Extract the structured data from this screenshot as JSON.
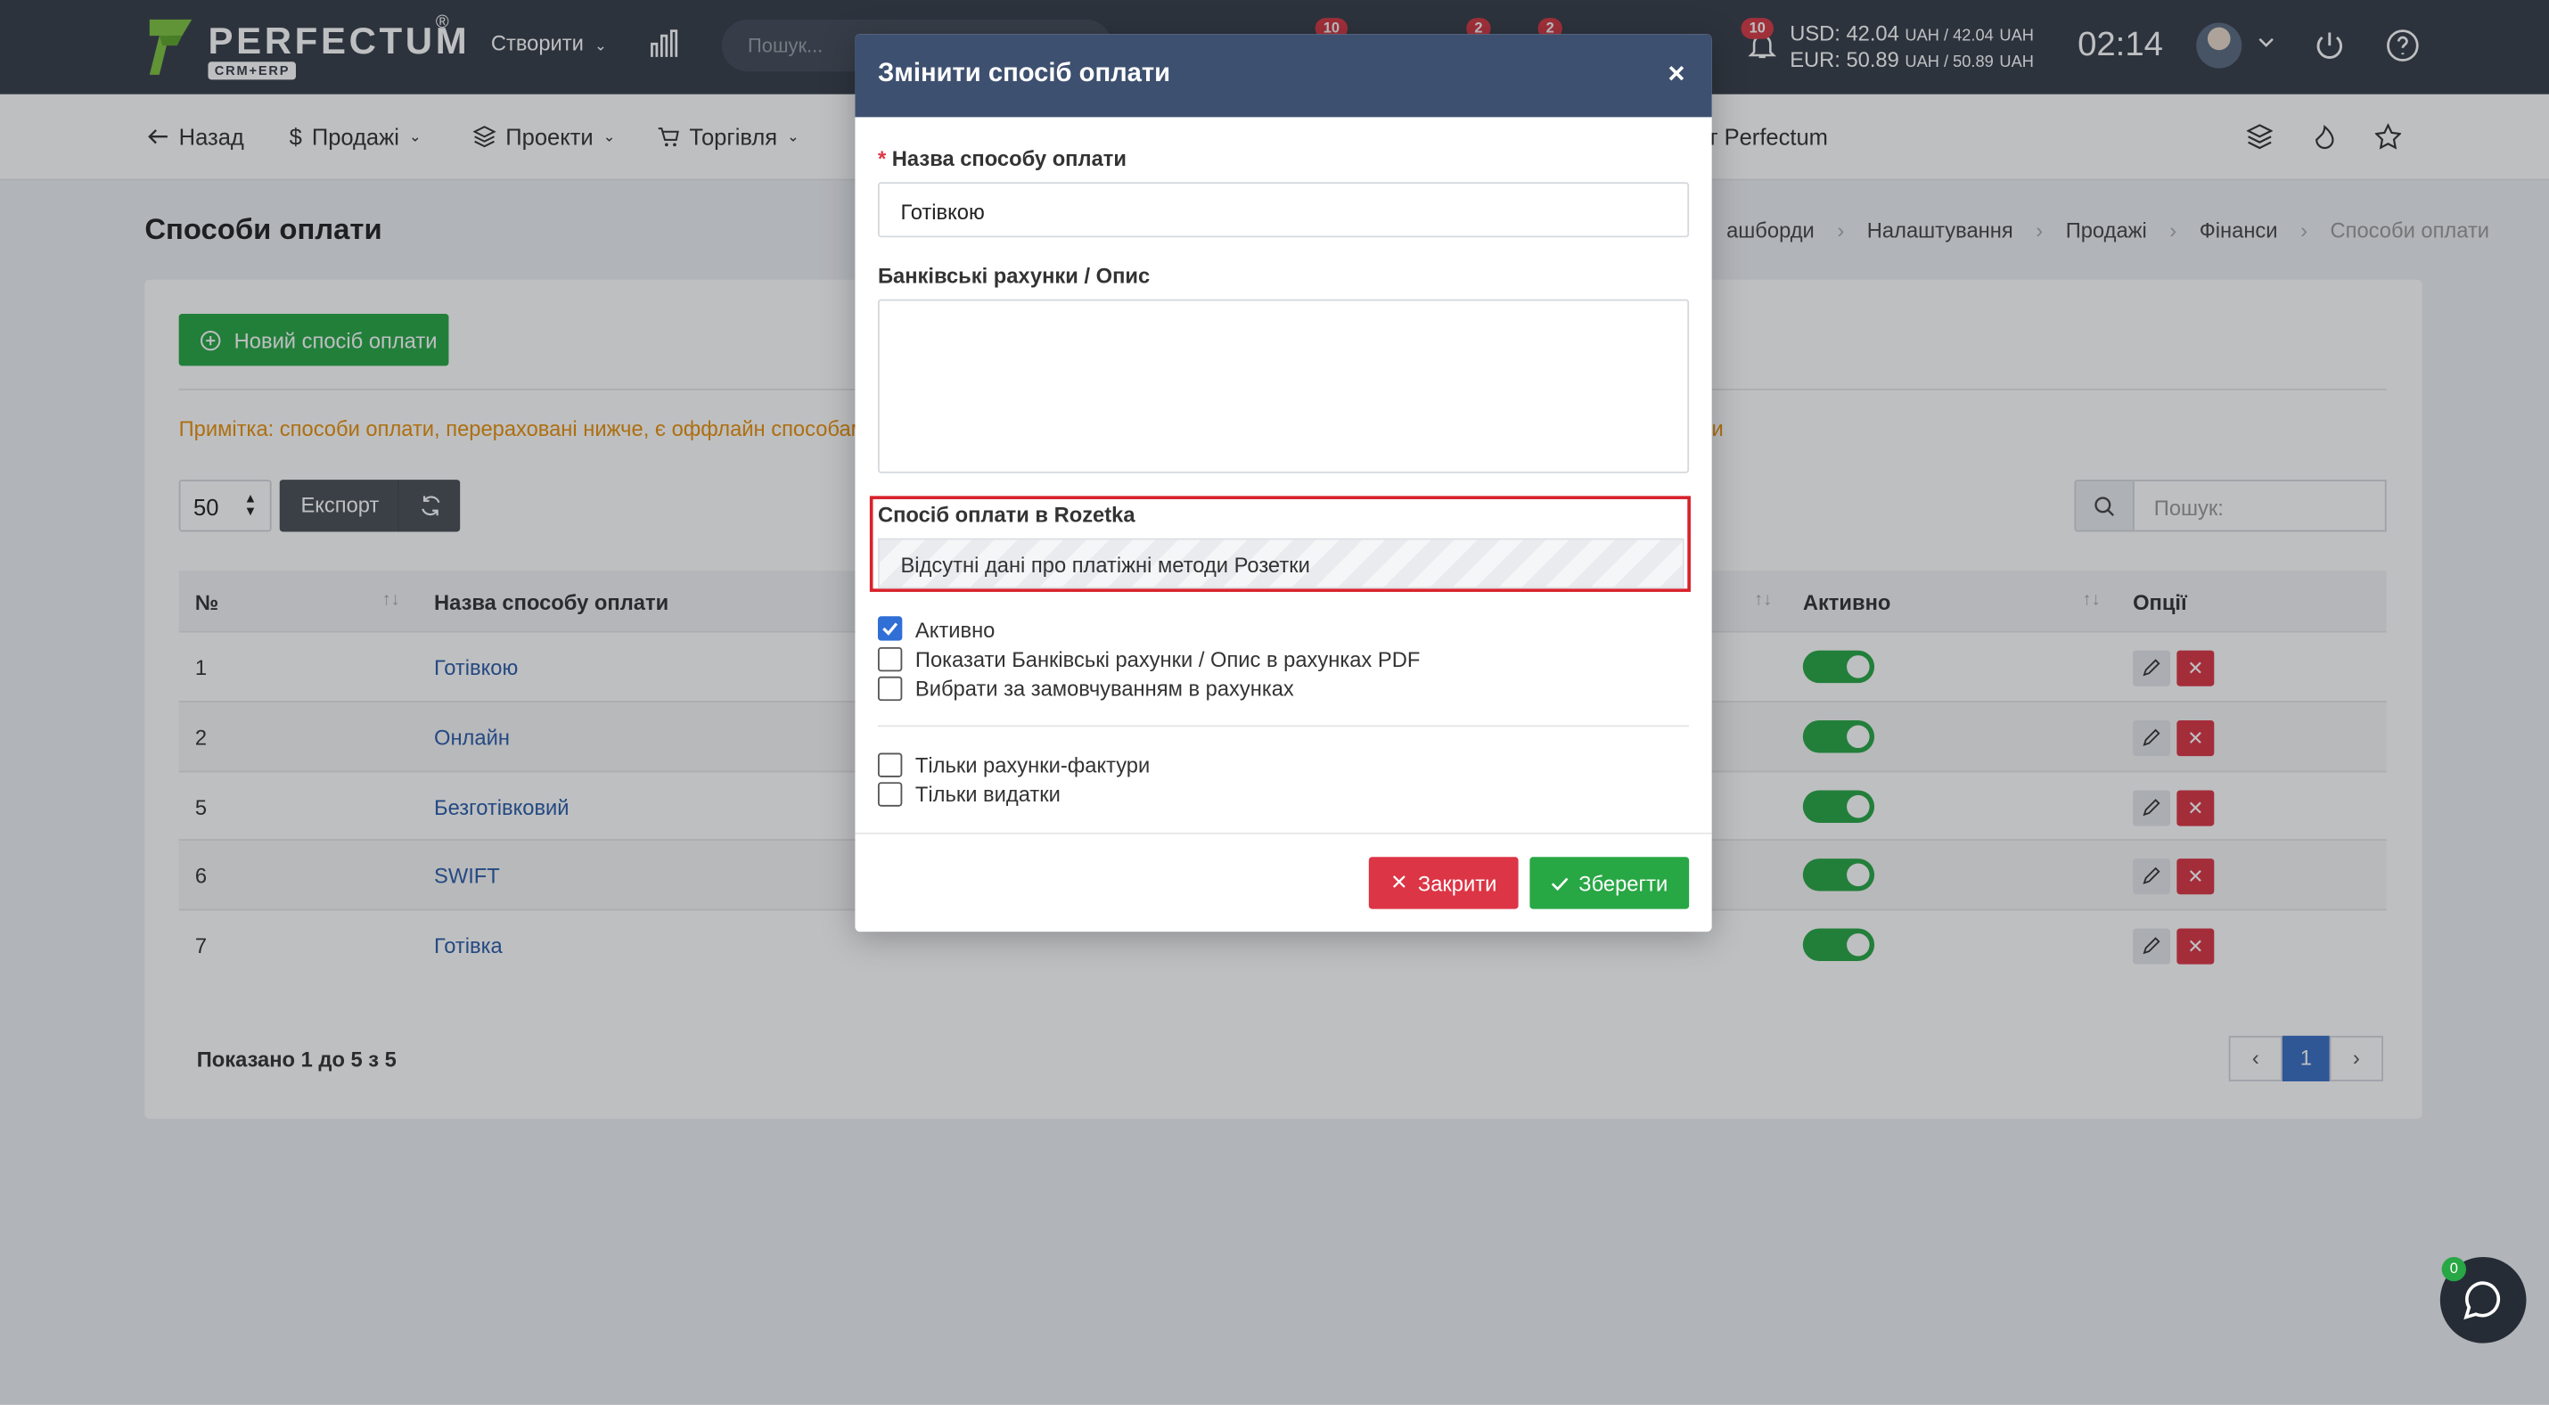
{
  "topbar": {
    "logo_text": "PERFECTUM",
    "logo_reg": "®",
    "logo_sub": "CRM+ERP",
    "create_label": "Створити",
    "search_placeholder": "Пошук...",
    "badges": [
      "10",
      "2",
      "2",
      "10"
    ],
    "currency_usd": "USD: 42.04",
    "currency_usd_unit": "UAH / 42.04",
    "currency_eur": "EUR: 50.89",
    "currency_eur_unit": "UAH / 50.89",
    "currency_unit": "UAH",
    "time": "02:14"
  },
  "nav": {
    "back": "Назад",
    "sales": "Продажі",
    "projects": "Проекти",
    "trade": "Торгівля",
    "perfectum": "ет Perfectum"
  },
  "page": {
    "title": "Способи оплати",
    "breadcrumb": [
      "ашборди",
      "Налаштування",
      "Продажі",
      "Фінанси",
      "Способи оплати"
    ]
  },
  "toolbar": {
    "new_button": "Новий спосіб оплати",
    "note_left": "Примітка: способи оплати, перераховані нижче, є оффлайн способами.",
    "note_right": "ми",
    "page_size": "50",
    "export": "Експорт",
    "search_placeholder": "Пошук:"
  },
  "table": {
    "headers": {
      "num": "№",
      "name": "Назва способу оплати",
      "active": "Активно",
      "options": "Опції"
    },
    "rows": [
      {
        "num": "1",
        "name": "Готівкою",
        "active": true
      },
      {
        "num": "2",
        "name": "Онлайн",
        "active": true
      },
      {
        "num": "5",
        "name": "Безготівковий",
        "active": true
      },
      {
        "num": "6",
        "name": "SWIFT",
        "active": true
      },
      {
        "num": "7",
        "name": "Готівка",
        "active": true
      }
    ],
    "footer": "Показано 1 до 5 з 5",
    "current_page": "1"
  },
  "modal": {
    "title": "Змінити спосіб оплати",
    "close_x": "×",
    "name_label": "Назва способу оплати",
    "name_required": "*",
    "name_value": "Готівкою",
    "desc_label": "Банківські рахунки / Опис",
    "desc_value": "",
    "rozetka_label": "Спосіб оплати в Rozetka",
    "rozetka_value": "Відсутні дані про платіжні методи Розетки",
    "checkboxes": [
      {
        "label": "Активно",
        "checked": true
      },
      {
        "label": "Показати Банківські рахунки / Опис  в рахунках PDF",
        "checked": false
      },
      {
        "label": "Вибрати за замовчуванням в рахунках",
        "checked": false
      },
      {
        "label": "Тільки рахунки-фактури",
        "checked": false
      },
      {
        "label": "Тільки видатки",
        "checked": false
      }
    ],
    "close_button": "Закрити",
    "save_button": "Зберегти"
  },
  "chat": {
    "badge": "0"
  },
  "colors": {
    "topbar": "#363d49",
    "modal_header": "#3e5070",
    "success": "#28a745",
    "danger": "#dc3545",
    "link": "#2a5ca8",
    "warning_text": "#e8910b",
    "highlight_border": "#d8222c"
  }
}
